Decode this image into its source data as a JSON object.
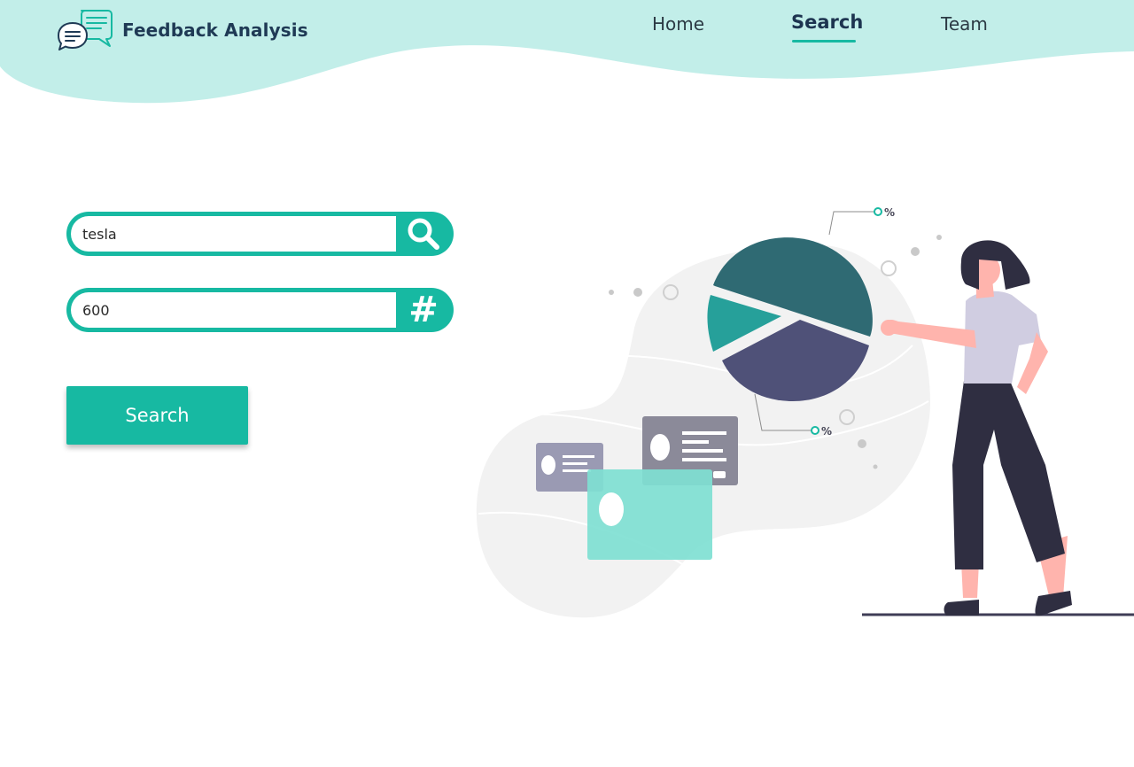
{
  "brand": {
    "name": "Feedback Analysis",
    "logo_icon": "chat-bubbles-icon"
  },
  "nav": {
    "items": [
      {
        "label": "Home",
        "active": false
      },
      {
        "label": "Search",
        "active": true
      },
      {
        "label": "Team",
        "active": false
      }
    ]
  },
  "form": {
    "keyword": {
      "value": "tesla",
      "icon": "search-icon"
    },
    "count": {
      "value": "600",
      "icon": "hash-icon",
      "glyph": "#"
    },
    "submit_label": "Search"
  },
  "illustration": {
    "pie_label_top": "%",
    "pie_label_bottom": "%"
  },
  "colors": {
    "accent": "#17b9a2",
    "header_bg": "#c2eee9",
    "brand_text": "#1f3a55",
    "pie_dark_teal": "#2f6a73",
    "pie_teal": "#26a09a",
    "pie_purple": "#4f5178"
  }
}
